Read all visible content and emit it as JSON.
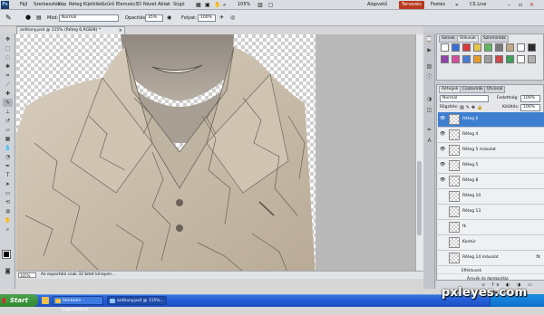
{
  "app": {
    "logo": "Ps",
    "menu": [
      "Fájl",
      "Szerkesztés",
      "Kép",
      "Réteg",
      "Kijelölés",
      "Szűrő",
      "Elemzés",
      "3D",
      "Nézet",
      "Ablak",
      "Súgó"
    ],
    "zoom": "105%",
    "workspaces": [
      "Alapvető",
      "Tervezés",
      "Festés"
    ],
    "active_workspace": "Tervezés",
    "cslive": "CS Live"
  },
  "options": {
    "mode_label": "Mód:",
    "mode_value": "Normál",
    "opacity_label": "Opacitás:",
    "opacity_value": "35%",
    "flow_label": "Folyat:",
    "flow_value": "100%"
  },
  "document": {
    "tab_title": "anthony.psd @ 115% (Réteg 6,RGB/8) *",
    "close": "×",
    "status_zoom": "105%",
    "status_info": "Az exportáló csak 32 bitet kínayon..."
  },
  "swatches_panel": {
    "tabs": [
      "Színek",
      "Stílusok",
      "Színminták"
    ],
    "active_tab": "Stílusok",
    "style_colors": [
      "#ffffff",
      "#3b6fd8",
      "#d83b3b",
      "#e3c74a",
      "#5fb85f",
      "#7a7a7a",
      "#c2a88a",
      "#ffffff",
      "#2c2c2c",
      "#8e44ad",
      "#d64c9a",
      "#4a7bd8",
      "#e69a2e",
      "#9e9e9e",
      "#c84a4a",
      "#3fa05a",
      "#ffffff",
      "#b0b0b0"
    ]
  },
  "layers_panel": {
    "tabs": [
      "Rétegek",
      "Csatornák",
      "Útvonal"
    ],
    "active_tab": "Rétegek",
    "blend_mode": "Normál",
    "opacity_label": "Fedettség:",
    "opacity_value": "100%",
    "lock_label": "Rögzítés:",
    "fill_label": "Kitöltés:",
    "fill_value": "100%",
    "layers": [
      {
        "name": "Réteg 6",
        "visible": true,
        "selected": true,
        "fx": false
      },
      {
        "name": "Réteg 4",
        "visible": true,
        "selected": false,
        "fx": false
      },
      {
        "name": "Réteg 5 másolat",
        "visible": true,
        "selected": false,
        "fx": false
      },
      {
        "name": "Réteg 5",
        "visible": true,
        "selected": false,
        "fx": false
      },
      {
        "name": "Réteg 8",
        "visible": true,
        "selected": false,
        "fx": false
      },
      {
        "name": "Réteg 10",
        "visible": false,
        "selected": false,
        "fx": false
      },
      {
        "name": "Réteg 13",
        "visible": false,
        "selected": false,
        "fx": false
      },
      {
        "name": "fk",
        "visible": false,
        "selected": false,
        "fx": false
      },
      {
        "name": "Kontúr",
        "visible": false,
        "selected": false,
        "fx": false
      },
      {
        "name": "Réteg 14 másolat",
        "visible": false,
        "selected": false,
        "fx": true
      }
    ],
    "effects_label": "Effektusok",
    "effect_item": "Árnyék és domborítás",
    "footer_icons": "∞ fx ◐ ◑ ▭ ▤ 🗑"
  },
  "taskbar": {
    "start": "Start",
    "tasks": [
      "fahrbahn - Jegyzettömb",
      "anthony.psd @ 115%..."
    ]
  },
  "watermark": "pxleyes.com"
}
